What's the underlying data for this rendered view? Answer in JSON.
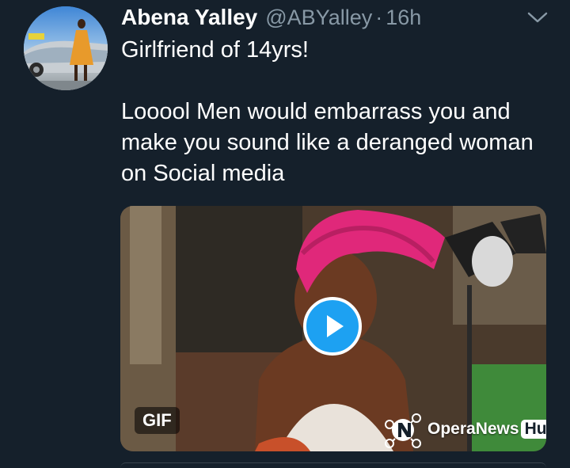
{
  "tweet": {
    "author_name": "Abena Yalley",
    "handle": "@ABYalley",
    "separator": "·",
    "time": "16h",
    "text": "Girlfriend of 14yrs!\n\nLooool Men would embarrass you and make you sound like a deranged woman on Social media"
  },
  "media": {
    "badge": "GIF",
    "watermark_text": "OperaNews",
    "watermark_badge": "Hub"
  },
  "icons": {
    "more": "chevron-down-icon",
    "play": "play-icon",
    "watermark": "opera-news-logo-icon"
  },
  "colors": {
    "background": "#15202b",
    "secondary_text": "#8899a6",
    "accent": "#1da1f2",
    "headwrap": "#e0287a"
  }
}
